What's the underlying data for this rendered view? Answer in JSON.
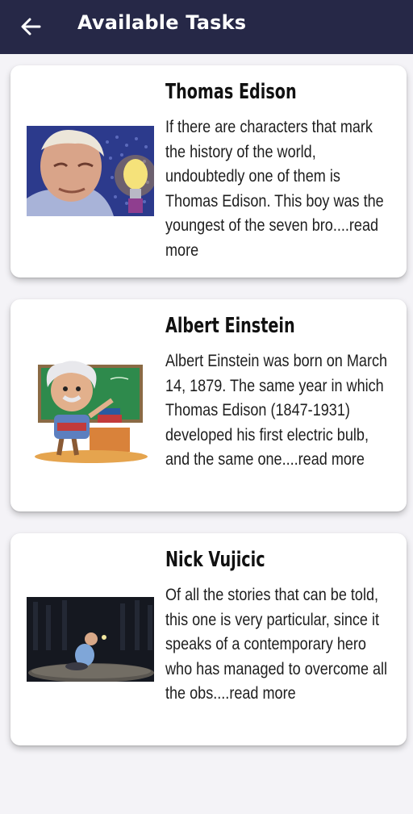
{
  "appbar": {
    "title": "Available Tasks",
    "back_icon": "arrow-left-icon",
    "background": "#262847"
  },
  "tasks": [
    {
      "title": "Thomas Edison",
      "text": "If there are characters that mark the history of the world, undoubtedly one of them is Thomas Edison. This boy was the youngest of the seven bro",
      "more": "....read more",
      "image": "thomas-edison-portrait-lightbulb"
    },
    {
      "title": "Albert Einstein",
      "text": "Albert Einstein was born on March 14, 1879. The same year in which Thomas Edison (1847-1931) developed his first electric bulb, and the same one",
      "more": "....read more",
      "image": "albert-einstein-cartoon-blackboard"
    },
    {
      "title": "Nick Vujicic",
      "text": "Of all the stories that can be told, this one is very particular, since it speaks of a contemporary hero who has managed to overcome all the obs",
      "more": "....read more",
      "image": "nick-vujicic-on-stage"
    }
  ]
}
